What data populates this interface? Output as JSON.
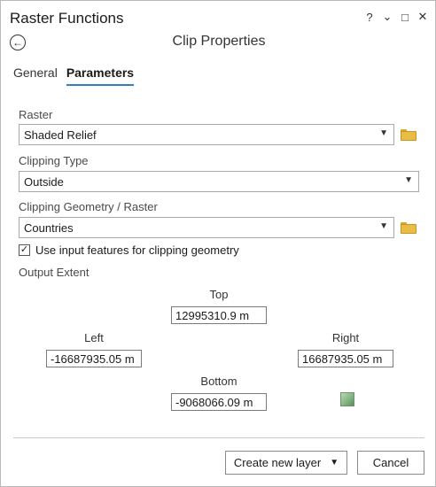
{
  "pane": {
    "title": "Raster Functions",
    "controls": {
      "help": "?",
      "options": "⌄",
      "maximize": "□",
      "close": "✕"
    }
  },
  "header": {
    "back_glyph": "←",
    "title": "Clip Properties"
  },
  "tabs": [
    {
      "label": "General",
      "active": false
    },
    {
      "label": "Parameters",
      "active": true
    }
  ],
  "form": {
    "raster": {
      "label": "Raster",
      "value": "Shaded Relief"
    },
    "clipping_type": {
      "label": "Clipping Type",
      "value": "Outside"
    },
    "clipping_geometry": {
      "label": "Clipping Geometry / Raster",
      "value": "Countries"
    },
    "use_input_features": {
      "label": "Use input features for clipping geometry",
      "checked": true
    },
    "output_extent": {
      "label": "Output Extent",
      "top": {
        "label": "Top",
        "value": "12995310.9 m"
      },
      "left": {
        "label": "Left",
        "value": "-16687935.05 m"
      },
      "right": {
        "label": "Right",
        "value": "16687935.05 m"
      },
      "bottom": {
        "label": "Bottom",
        "value": "-9068066.09 m"
      }
    }
  },
  "footer": {
    "create_label": "Create new layer",
    "cancel_label": "Cancel"
  },
  "icons": {
    "folder": "folder-icon",
    "map": "map-extent-icon"
  },
  "colors": {
    "accent": "#2f7fbf",
    "folder": "#e9bd45"
  }
}
